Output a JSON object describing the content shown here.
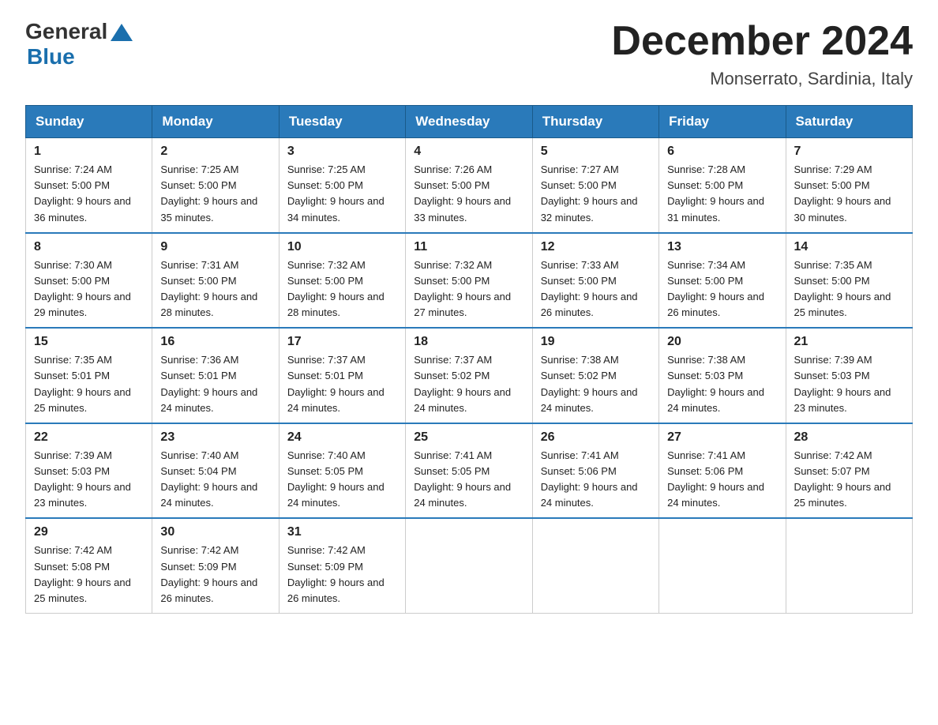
{
  "logo": {
    "general": "General",
    "blue": "Blue"
  },
  "title": "December 2024",
  "location": "Monserrato, Sardinia, Italy",
  "headers": [
    "Sunday",
    "Monday",
    "Tuesday",
    "Wednesday",
    "Thursday",
    "Friday",
    "Saturday"
  ],
  "weeks": [
    [
      {
        "day": "1",
        "sunrise": "7:24 AM",
        "sunset": "5:00 PM",
        "daylight": "9 hours and 36 minutes."
      },
      {
        "day": "2",
        "sunrise": "7:25 AM",
        "sunset": "5:00 PM",
        "daylight": "9 hours and 35 minutes."
      },
      {
        "day": "3",
        "sunrise": "7:25 AM",
        "sunset": "5:00 PM",
        "daylight": "9 hours and 34 minutes."
      },
      {
        "day": "4",
        "sunrise": "7:26 AM",
        "sunset": "5:00 PM",
        "daylight": "9 hours and 33 minutes."
      },
      {
        "day": "5",
        "sunrise": "7:27 AM",
        "sunset": "5:00 PM",
        "daylight": "9 hours and 32 minutes."
      },
      {
        "day": "6",
        "sunrise": "7:28 AM",
        "sunset": "5:00 PM",
        "daylight": "9 hours and 31 minutes."
      },
      {
        "day": "7",
        "sunrise": "7:29 AM",
        "sunset": "5:00 PM",
        "daylight": "9 hours and 30 minutes."
      }
    ],
    [
      {
        "day": "8",
        "sunrise": "7:30 AM",
        "sunset": "5:00 PM",
        "daylight": "9 hours and 29 minutes."
      },
      {
        "day": "9",
        "sunrise": "7:31 AM",
        "sunset": "5:00 PM",
        "daylight": "9 hours and 28 minutes."
      },
      {
        "day": "10",
        "sunrise": "7:32 AM",
        "sunset": "5:00 PM",
        "daylight": "9 hours and 28 minutes."
      },
      {
        "day": "11",
        "sunrise": "7:32 AM",
        "sunset": "5:00 PM",
        "daylight": "9 hours and 27 minutes."
      },
      {
        "day": "12",
        "sunrise": "7:33 AM",
        "sunset": "5:00 PM",
        "daylight": "9 hours and 26 minutes."
      },
      {
        "day": "13",
        "sunrise": "7:34 AM",
        "sunset": "5:00 PM",
        "daylight": "9 hours and 26 minutes."
      },
      {
        "day": "14",
        "sunrise": "7:35 AM",
        "sunset": "5:00 PM",
        "daylight": "9 hours and 25 minutes."
      }
    ],
    [
      {
        "day": "15",
        "sunrise": "7:35 AM",
        "sunset": "5:01 PM",
        "daylight": "9 hours and 25 minutes."
      },
      {
        "day": "16",
        "sunrise": "7:36 AM",
        "sunset": "5:01 PM",
        "daylight": "9 hours and 24 minutes."
      },
      {
        "day": "17",
        "sunrise": "7:37 AM",
        "sunset": "5:01 PM",
        "daylight": "9 hours and 24 minutes."
      },
      {
        "day": "18",
        "sunrise": "7:37 AM",
        "sunset": "5:02 PM",
        "daylight": "9 hours and 24 minutes."
      },
      {
        "day": "19",
        "sunrise": "7:38 AM",
        "sunset": "5:02 PM",
        "daylight": "9 hours and 24 minutes."
      },
      {
        "day": "20",
        "sunrise": "7:38 AM",
        "sunset": "5:03 PM",
        "daylight": "9 hours and 24 minutes."
      },
      {
        "day": "21",
        "sunrise": "7:39 AM",
        "sunset": "5:03 PM",
        "daylight": "9 hours and 23 minutes."
      }
    ],
    [
      {
        "day": "22",
        "sunrise": "7:39 AM",
        "sunset": "5:03 PM",
        "daylight": "9 hours and 23 minutes."
      },
      {
        "day": "23",
        "sunrise": "7:40 AM",
        "sunset": "5:04 PM",
        "daylight": "9 hours and 24 minutes."
      },
      {
        "day": "24",
        "sunrise": "7:40 AM",
        "sunset": "5:05 PM",
        "daylight": "9 hours and 24 minutes."
      },
      {
        "day": "25",
        "sunrise": "7:41 AM",
        "sunset": "5:05 PM",
        "daylight": "9 hours and 24 minutes."
      },
      {
        "day": "26",
        "sunrise": "7:41 AM",
        "sunset": "5:06 PM",
        "daylight": "9 hours and 24 minutes."
      },
      {
        "day": "27",
        "sunrise": "7:41 AM",
        "sunset": "5:06 PM",
        "daylight": "9 hours and 24 minutes."
      },
      {
        "day": "28",
        "sunrise": "7:42 AM",
        "sunset": "5:07 PM",
        "daylight": "9 hours and 25 minutes."
      }
    ],
    [
      {
        "day": "29",
        "sunrise": "7:42 AM",
        "sunset": "5:08 PM",
        "daylight": "9 hours and 25 minutes."
      },
      {
        "day": "30",
        "sunrise": "7:42 AM",
        "sunset": "5:09 PM",
        "daylight": "9 hours and 26 minutes."
      },
      {
        "day": "31",
        "sunrise": "7:42 AM",
        "sunset": "5:09 PM",
        "daylight": "9 hours and 26 minutes."
      },
      null,
      null,
      null,
      null
    ]
  ]
}
